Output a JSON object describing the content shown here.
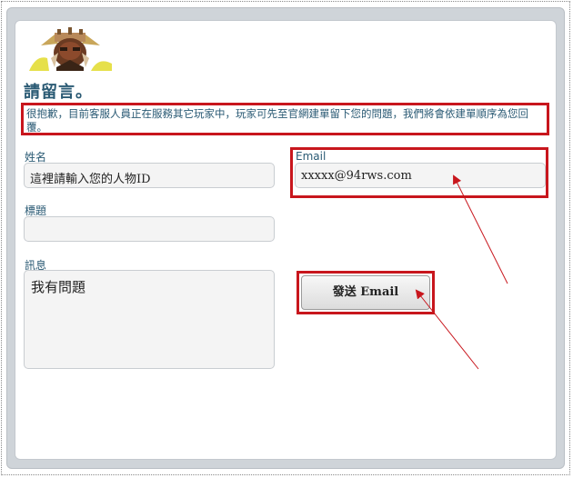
{
  "page": {
    "title": "請留言。",
    "notice": "很抱歉，目前客服人員正在服務其它玩家中，玩家可先至官網建單留下您的問題，我們將會依建單順序為您回覆。"
  },
  "form": {
    "name_label": "姓名",
    "name_value": "這裡請輸入您的人物ID",
    "email_label": "Email",
    "email_value": "xxxxx@94rws.com",
    "subject_label": "標題",
    "subject_value": "",
    "message_label": "訊息",
    "message_value": "我有問題",
    "send_label": "發送 Email"
  },
  "colors": {
    "highlight": "#c8161d",
    "label": "#2a5a74",
    "arrow": "#c8161d"
  },
  "icons": {
    "logo": "game-character-logo-icon",
    "arrows": "red-pointer-arrow-icon"
  }
}
